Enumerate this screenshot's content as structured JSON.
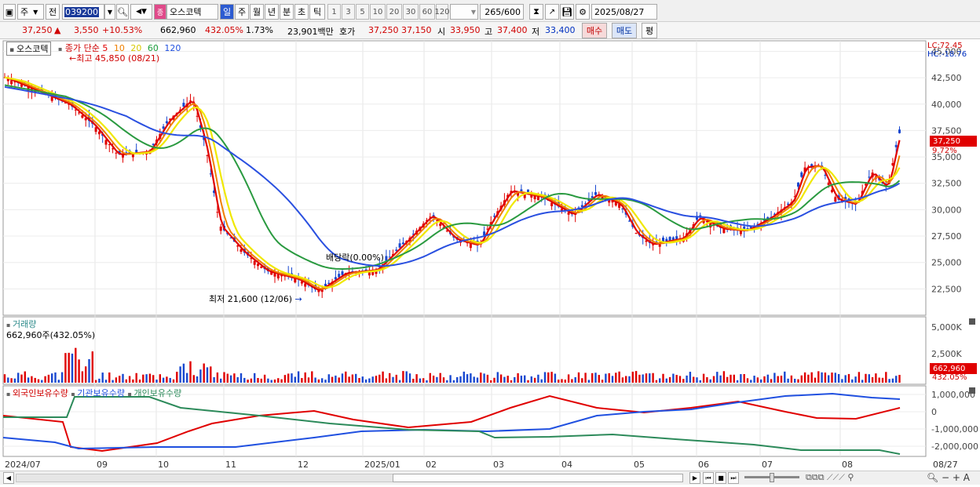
{
  "toolbar": {
    "market": "주",
    "mode": "전",
    "code": "039200",
    "stock_name": "오스코텍",
    "periods": [
      "일",
      "주",
      "월",
      "년",
      "분",
      "초",
      "틱"
    ],
    "active_period": "일",
    "intervals": [
      "1",
      "3",
      "5",
      "10",
      "20",
      "30",
      "60",
      "120"
    ],
    "count": "265",
    "count_max": "/600",
    "date": "2025/08/27"
  },
  "quote": {
    "price": "37,250",
    "change": "3,550",
    "change_pct": "+10.53%",
    "volume": "662,960",
    "volume_pct": "432.05%",
    "turnover_pct": "1.73%",
    "amount": "23,901백만",
    "hoga_label": "호가",
    "ask": "37,250",
    "bid": "37,150",
    "open_label": "시",
    "open": "33,950",
    "high_label": "고",
    "high": "37,400",
    "low_label": "저",
    "low": "33,400",
    "buy_btn": "매수",
    "sell_btn": "매도",
    "eval_btn": "평"
  },
  "price_panel": {
    "stock_tag": "오스코텍",
    "legend_title": "종가 단순",
    "ma_labels": [
      "5",
      "10",
      "20",
      "60",
      "120"
    ],
    "ma_colors": [
      "#e00000",
      "#f08000",
      "#e8e800",
      "#20a040",
      "#2050e0"
    ],
    "lc": "LC:72.45",
    "hc": "HC:-18.76",
    "high_note": "최고 45,850 (08/21)",
    "low_note": "최저 21,600 (12/06)",
    "dividend_note": "배당락(0.00%)",
    "y_ticks": [
      "45,000",
      "42,500",
      "40,000",
      "37,500",
      "35,000",
      "32,500",
      "30,000",
      "27,500",
      "25,000",
      "22,500"
    ],
    "current_box": "37,250",
    "current_pct": "9.72%"
  },
  "volume_panel": {
    "title": "거래량",
    "value": "662,960주(432.05%)",
    "y_ticks": [
      "5,000K",
      "2,500K"
    ],
    "current_box": "662,960",
    "current_pct": "432.05%"
  },
  "holding_panel": {
    "titles": [
      "외국인보유수량",
      "기관보유수량",
      "개인보유수량"
    ],
    "y_ticks": [
      "1,000,000",
      "0",
      "-1,000,000",
      "-2,000,000"
    ]
  },
  "x_axis": [
    "2024/07",
    "09",
    "10",
    "11",
    "12",
    "2025/01",
    "02",
    "03",
    "04",
    "05",
    "06",
    "07",
    "08",
    "08/27"
  ]
}
